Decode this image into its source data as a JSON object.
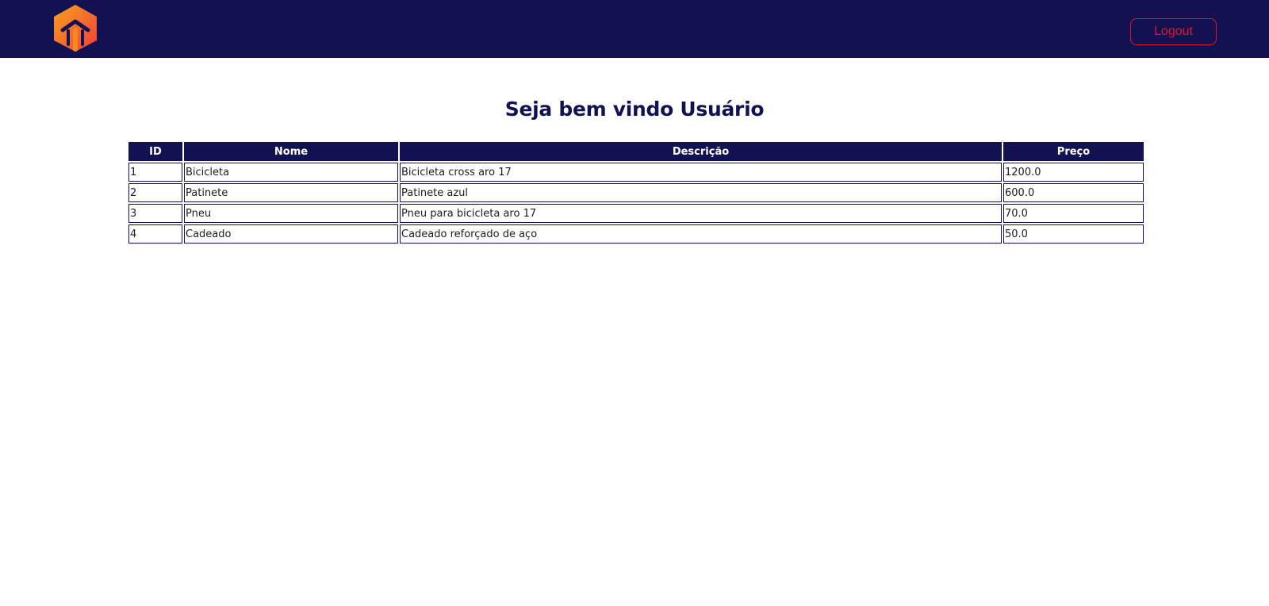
{
  "header": {
    "logo_icon": "orange-house-arrow-logo-icon",
    "logo_colors": [
      "#f7921e",
      "#f04e3c"
    ],
    "logout_label": "Logout",
    "background_color": "#131250",
    "logout_color": "#e8102e"
  },
  "main": {
    "title": "Seja bem vindo Usuário",
    "table": {
      "headers": [
        "ID",
        "Nome",
        "Descrição",
        "Preço"
      ],
      "rows": [
        [
          "1",
          "Bicicleta",
          "Bicicleta cross aro 17",
          "1200.0"
        ],
        [
          "2",
          "Patinete",
          "Patinete azul",
          "600.0"
        ],
        [
          "3",
          "Pneu",
          "Pneu para bicicleta aro 17",
          "70.0"
        ],
        [
          "4",
          "Cadeado",
          "Cadeado reforçado de aço",
          "50.0"
        ]
      ]
    }
  }
}
